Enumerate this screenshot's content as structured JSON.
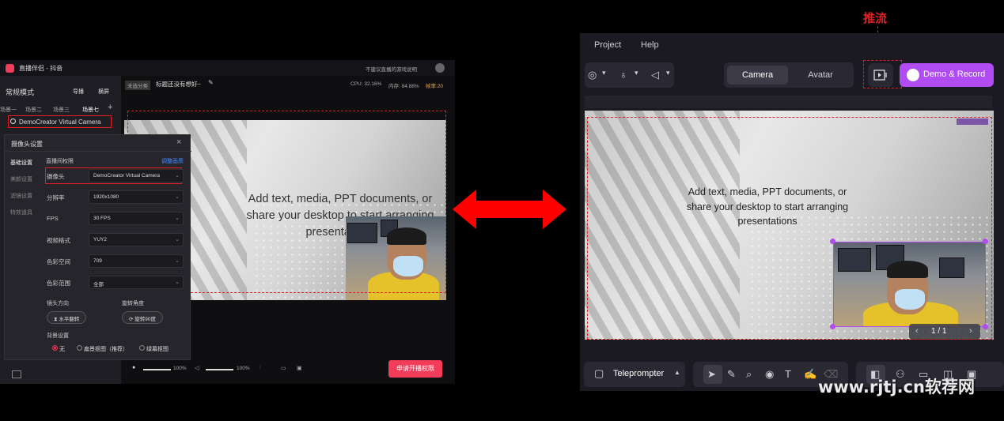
{
  "left_app": {
    "title": "直播伴侣 - 抖音",
    "title_right": "不建议直播的游戏说明",
    "mode": "常规模式",
    "mode_actions": [
      "导播",
      "横屏"
    ],
    "scenes": [
      "场景一",
      "场景二",
      "场景三",
      "场景七"
    ],
    "add_scene": "+",
    "source_item": "DemoCreator Virtual Camera",
    "stream_tag": "未选分类",
    "stream_title": "标题还没有想好~",
    "stats": {
      "cpu": "CPU: 32.16%",
      "mem": "内存: 84.88%",
      "fps": "帧率:20"
    },
    "dialog": {
      "title": "摄像头设置",
      "close": "×",
      "nav": [
        "基础设置",
        "美颜设置",
        "滤镜设置",
        "特效道具"
      ],
      "section": "直播间权限",
      "adjust_link": "调整画质",
      "fields": [
        {
          "label": "摄像头",
          "value": "DemoCreator Virtual Camera"
        },
        {
          "label": "分辨率",
          "value": "1920x1080"
        },
        {
          "label": "FPS",
          "value": "30 FPS"
        },
        {
          "label": "视频格式",
          "value": "YUY2"
        },
        {
          "label": "色彩空间",
          "value": "709"
        },
        {
          "label": "色彩范围",
          "value": "全部"
        }
      ],
      "lens_label": "镜头方向",
      "rotate_label": "旋转角度",
      "mirror_btn": "水平翻转",
      "rotate_btn": "旋转90度",
      "bg_label": "背景设置",
      "bg_options": [
        "无",
        "扁景抠图（推荐）",
        "绿幕抠图"
      ]
    },
    "volume": {
      "mic": "100%",
      "speaker": "100%"
    },
    "apply_button": "申请开播权限",
    "slide_text": [
      "Add text, media, PPT documents, or",
      "share your desktop to start arranging",
      "presentations"
    ]
  },
  "right_app": {
    "annotation": "推流",
    "menu": [
      "Project",
      "Help"
    ],
    "tabs": [
      "Camera",
      "Avatar"
    ],
    "active_tab": "Camera",
    "demo_button": "Demo & Record",
    "slide_text": [
      "Add text, media, PPT documents, or",
      "share your desktop to start arranging",
      "presentations"
    ],
    "page_counter": "1 / 1",
    "teleprompter": "Teleprompter",
    "accent_color": "#b04cf2"
  },
  "watermark": "www.rjtj.cn软荐网"
}
